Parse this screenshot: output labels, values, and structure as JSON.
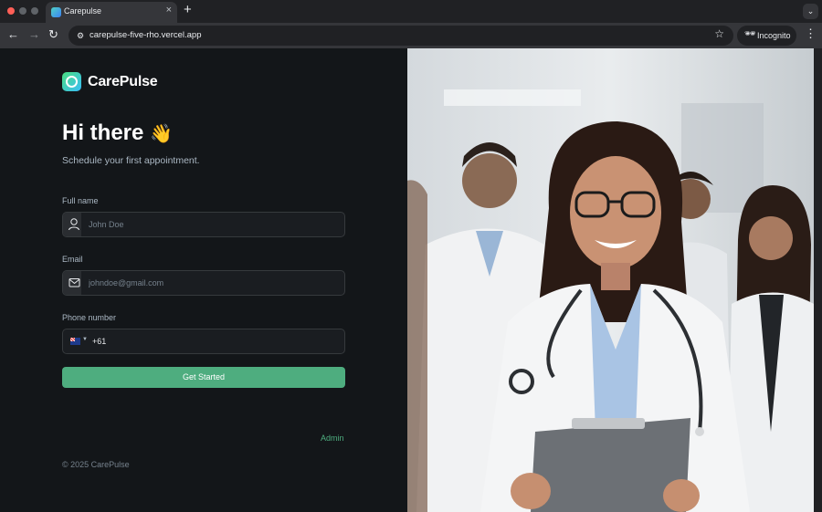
{
  "browser": {
    "tab_title": "Carepulse",
    "tab_close": "×",
    "new_tab": "+",
    "tab_search": "⌄",
    "url": "carepulse-five-rho.vercel.app",
    "back": "←",
    "forward": "→",
    "reload": "↻",
    "site_info": "⚙",
    "star": "☆",
    "incognito_icon": "🕶",
    "incognito_label": "Incognito",
    "menu": "⋮"
  },
  "brand": {
    "name": "CarePulse"
  },
  "hero": {
    "title": "Hi there",
    "wave": "👋",
    "subtitle": "Schedule your first appointment."
  },
  "form": {
    "full_name_label": "Full name",
    "full_name_placeholder": "John Doe",
    "email_label": "Email",
    "email_placeholder": "johndoe@gmail.com",
    "phone_label": "Phone number",
    "phone_code": "+61",
    "submit_label": "Get Started"
  },
  "footer": {
    "admin_link": "Admin",
    "copyright": "© 2025 CarePulse"
  },
  "colors": {
    "accent": "#4ead7f",
    "page_bg": "#131619",
    "field_bg": "#1a1d21",
    "chrome_bg": "#202124"
  },
  "icons": [
    "user-icon",
    "mail-icon",
    "australia-flag-icon",
    "waving-hand-icon"
  ]
}
